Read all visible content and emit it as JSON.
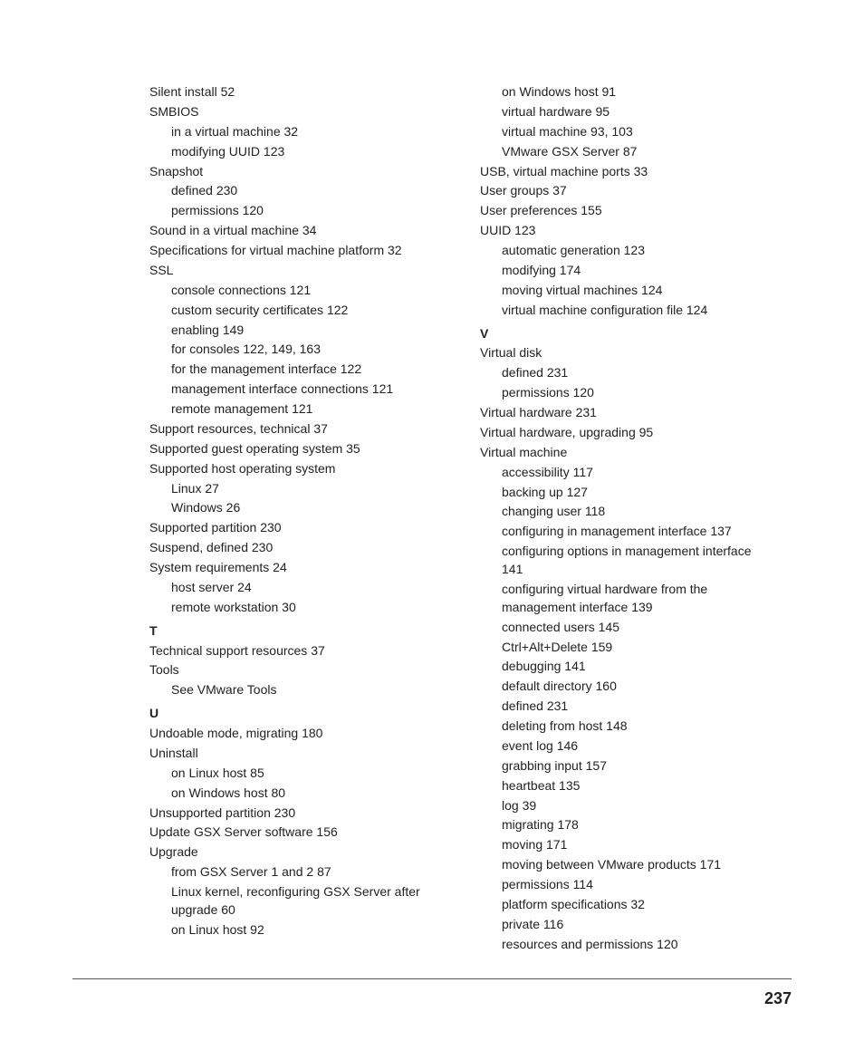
{
  "page_number": "237",
  "left_column": [
    {
      "type": "entry",
      "text": "Silent install 52"
    },
    {
      "type": "entry",
      "text": "SMBIOS"
    },
    {
      "type": "sub",
      "text": "in a virtual machine 32"
    },
    {
      "type": "sub",
      "text": "modifying UUID 123"
    },
    {
      "type": "entry",
      "text": "Snapshot"
    },
    {
      "type": "sub",
      "text": "defined 230"
    },
    {
      "type": "sub",
      "text": "permissions 120"
    },
    {
      "type": "entry",
      "text": "Sound in a virtual machine 34"
    },
    {
      "type": "entry",
      "text": "Specifications for virtual machine platform 32"
    },
    {
      "type": "entry",
      "text": "SSL"
    },
    {
      "type": "sub",
      "text": "console connections 121"
    },
    {
      "type": "sub",
      "text": "custom security certificates 122"
    },
    {
      "type": "sub",
      "text": "enabling 149"
    },
    {
      "type": "sub",
      "text": "for consoles 122, 149, 163"
    },
    {
      "type": "sub",
      "text": "for the management interface 122"
    },
    {
      "type": "sub",
      "text": "management interface connections 121"
    },
    {
      "type": "sub",
      "text": "remote management 121"
    },
    {
      "type": "entry",
      "text": "Support resources, technical 37"
    },
    {
      "type": "entry",
      "text": "Supported guest operating system 35"
    },
    {
      "type": "entry",
      "text": "Supported host operating system"
    },
    {
      "type": "sub",
      "text": "Linux 27"
    },
    {
      "type": "sub",
      "text": "Windows 26"
    },
    {
      "type": "entry",
      "text": "Supported partition 230"
    },
    {
      "type": "entry",
      "text": "Suspend, defined 230"
    },
    {
      "type": "entry",
      "text": "System requirements 24"
    },
    {
      "type": "sub",
      "text": "host server 24"
    },
    {
      "type": "sub",
      "text": "remote workstation 30"
    },
    {
      "type": "head",
      "text": "T"
    },
    {
      "type": "entry",
      "text": "Technical support resources 37"
    },
    {
      "type": "entry",
      "text": "Tools"
    },
    {
      "type": "sub",
      "text": "See VMware Tools"
    },
    {
      "type": "head",
      "text": "U"
    },
    {
      "type": "entry",
      "text": "Undoable mode, migrating 180"
    },
    {
      "type": "entry",
      "text": "Uninstall"
    },
    {
      "type": "sub",
      "text": "on Linux host 85"
    },
    {
      "type": "sub",
      "text": "on Windows host 80"
    },
    {
      "type": "entry",
      "text": "Unsupported partition 230"
    },
    {
      "type": "entry",
      "text": "Update GSX Server software 156"
    },
    {
      "type": "entry",
      "text": "Upgrade"
    },
    {
      "type": "sub",
      "text": "from GSX Server 1 and 2 87"
    },
    {
      "type": "sub",
      "text": "Linux kernel, reconfiguring GSX Server after upgrade 60"
    },
    {
      "type": "sub",
      "text": "on Linux host 92"
    }
  ],
  "right_column": [
    {
      "type": "sub",
      "text": "on Windows host 91"
    },
    {
      "type": "sub",
      "text": "virtual hardware 95"
    },
    {
      "type": "sub",
      "text": "virtual machine 93, 103"
    },
    {
      "type": "sub",
      "text": "VMware GSX Server 87"
    },
    {
      "type": "entry",
      "text": "USB, virtual machine ports 33"
    },
    {
      "type": "entry",
      "text": "User groups 37"
    },
    {
      "type": "entry",
      "text": "User preferences 155"
    },
    {
      "type": "entry",
      "text": "UUID 123"
    },
    {
      "type": "sub",
      "text": "automatic generation 123"
    },
    {
      "type": "sub",
      "text": "modifying 174"
    },
    {
      "type": "sub",
      "text": "moving virtual machines 124"
    },
    {
      "type": "sub",
      "text": "virtual machine configuration file 124"
    },
    {
      "type": "head",
      "text": "V"
    },
    {
      "type": "entry",
      "text": "Virtual disk"
    },
    {
      "type": "sub",
      "text": "defined 231"
    },
    {
      "type": "sub",
      "text": "permissions 120"
    },
    {
      "type": "entry",
      "text": "Virtual hardware 231"
    },
    {
      "type": "entry",
      "text": "Virtual hardware, upgrading 95"
    },
    {
      "type": "entry",
      "text": "Virtual machine"
    },
    {
      "type": "sub",
      "text": "accessibility 117"
    },
    {
      "type": "sub",
      "text": "backing up 127"
    },
    {
      "type": "sub",
      "text": "changing user 118"
    },
    {
      "type": "sub",
      "text": "configuring in management interface 137"
    },
    {
      "type": "sub",
      "text": "configuring options in management interface 141"
    },
    {
      "type": "sub",
      "text": "configuring virtual hardware from the management interface 139"
    },
    {
      "type": "sub",
      "text": "connected users 145"
    },
    {
      "type": "sub",
      "text": "Ctrl+Alt+Delete 159"
    },
    {
      "type": "sub",
      "text": "debugging 141"
    },
    {
      "type": "sub",
      "text": "default directory 160"
    },
    {
      "type": "sub",
      "text": "defined 231"
    },
    {
      "type": "sub",
      "text": "deleting from host 148"
    },
    {
      "type": "sub",
      "text": "event log 146"
    },
    {
      "type": "sub",
      "text": "grabbing input 157"
    },
    {
      "type": "sub",
      "text": "heartbeat 135"
    },
    {
      "type": "sub",
      "text": "log 39"
    },
    {
      "type": "sub",
      "text": "migrating 178"
    },
    {
      "type": "sub",
      "text": "moving 171"
    },
    {
      "type": "sub",
      "text": "moving between VMware products 171"
    },
    {
      "type": "sub",
      "text": "permissions 114"
    },
    {
      "type": "sub",
      "text": "platform specifications 32"
    },
    {
      "type": "sub",
      "text": "private 116"
    },
    {
      "type": "sub",
      "text": "resources and permissions 120"
    }
  ]
}
